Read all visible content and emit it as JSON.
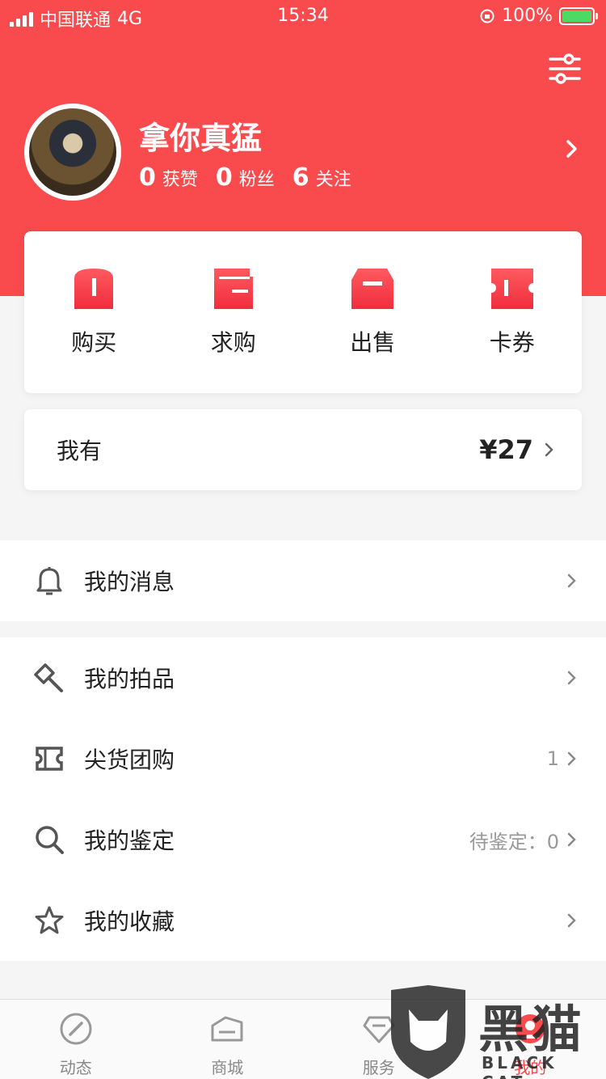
{
  "status_bar": {
    "carrier": "中国联通",
    "network": "4G",
    "time": "15:34",
    "battery": "100%"
  },
  "profile": {
    "name": "拿你真猛",
    "stats": [
      {
        "num": "0",
        "label": "获赞"
      },
      {
        "num": "0",
        "label": "粉丝"
      },
      {
        "num": "6",
        "label": "关注"
      }
    ]
  },
  "actions": [
    {
      "label": "购买",
      "icon": "shopping-bag-icon"
    },
    {
      "label": "求购",
      "icon": "wallet-icon"
    },
    {
      "label": "出售",
      "icon": "box-icon"
    },
    {
      "label": "卡券",
      "icon": "ticket-icon"
    }
  ],
  "wallet": {
    "label": "我有",
    "value": "¥27"
  },
  "menu": {
    "messages": {
      "label": "我的消息"
    },
    "auction": {
      "label": "我的拍品"
    },
    "group_buy": {
      "label": "尖货团购",
      "extra": "1"
    },
    "appraisal": {
      "label": "我的鉴定",
      "extra": "待鉴定：0"
    },
    "favorites": {
      "label": "我的收藏"
    }
  },
  "tabs": [
    {
      "label": "动态",
      "icon": "compass-icon"
    },
    {
      "label": "商城",
      "icon": "store-icon"
    },
    {
      "label": "服务",
      "icon": "diamond-icon"
    },
    {
      "label": "我的",
      "icon": "user-icon"
    }
  ],
  "watermark": {
    "text": "黑猫",
    "sub": "BLACK CAT"
  },
  "colors": {
    "brand": "#f94a4d",
    "background": "#f5f5f5"
  }
}
